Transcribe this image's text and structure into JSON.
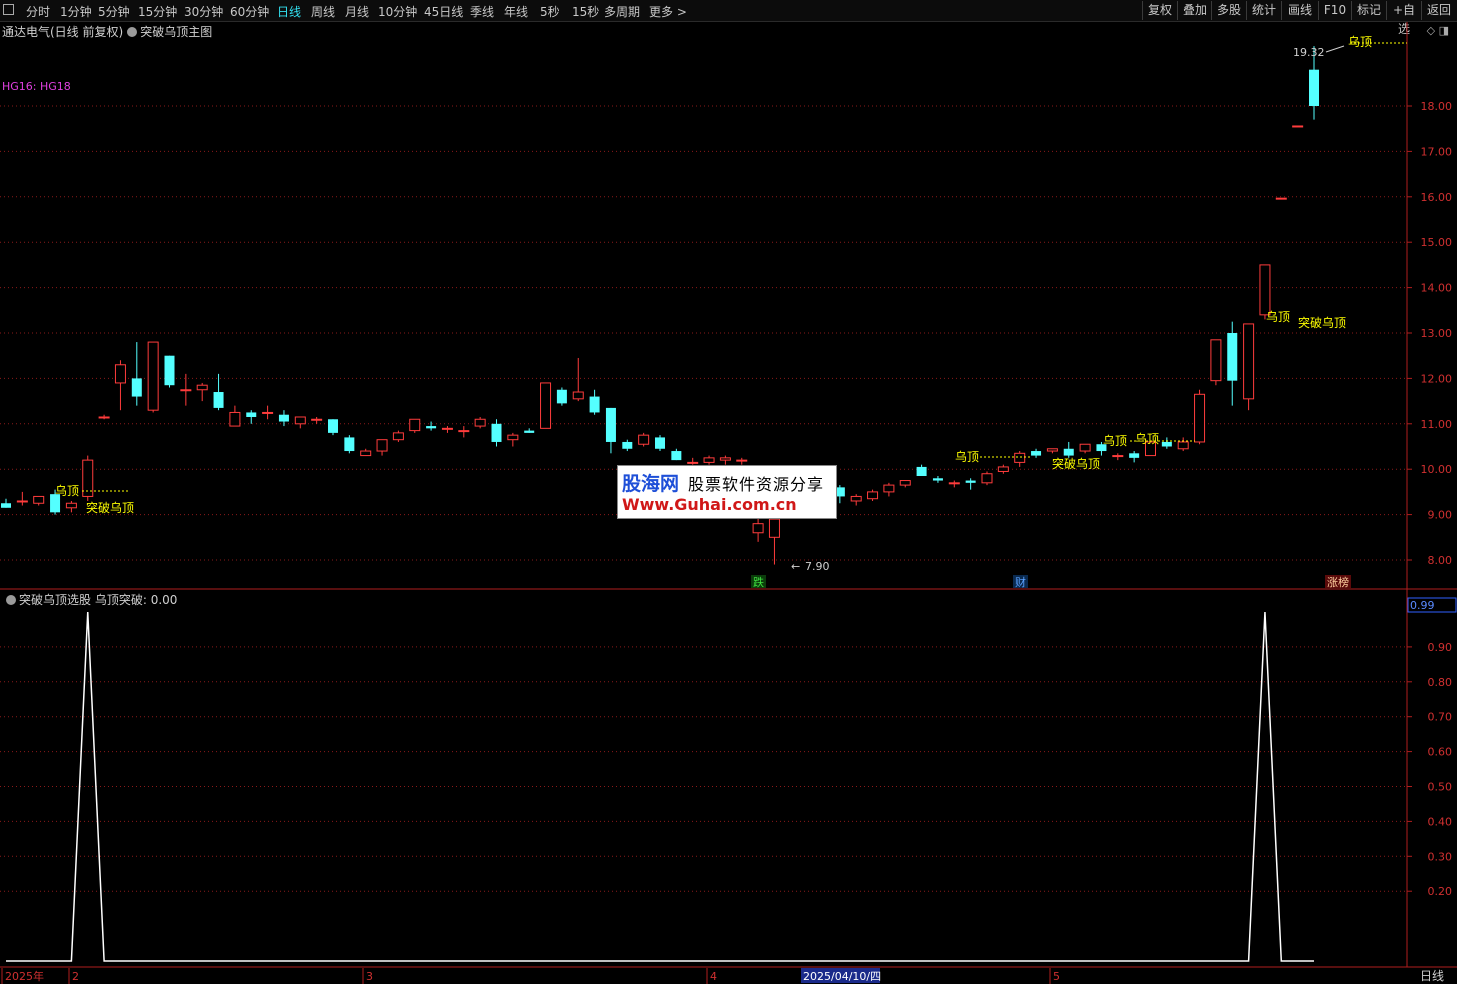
{
  "toolbar": {
    "periods": [
      "分时",
      "1分钟",
      "5分钟",
      "15分钟",
      "30分钟",
      "60分钟",
      "日线",
      "周线",
      "月线",
      "10分钟",
      "45日线",
      "季线",
      "年线",
      "5秒",
      "15秒",
      "多周期",
      "更多 >"
    ],
    "active": "日线",
    "right_buttons": [
      "复权",
      "叠加",
      "多股",
      "统计",
      "画线",
      "F10",
      "标记",
      "+自选",
      "返回"
    ]
  },
  "main_panel": {
    "stock_info": "通达电气(日线 前复权)",
    "indicator_name": "突破乌顶主图",
    "hg_label": "HG16: HG18",
    "top_icons": "◇ ◨",
    "price_axis": [
      "18.00",
      "17.00",
      "16.00",
      "15.00",
      "14.00",
      "13.00",
      "12.00",
      "11.00",
      "10.00",
      "9.00",
      "8.00"
    ],
    "high_marker": "19.32",
    "low_marker": "7.90",
    "signal_labels": [
      "乌顶",
      "突破乌顶"
    ],
    "event_tags": [
      "跌",
      "财",
      "涨榜"
    ]
  },
  "sub_panel": {
    "indicator_name": "突破乌顶选股",
    "value_label": "乌顶突破: 0.00",
    "current_value": "0.99",
    "axis": [
      "0.90",
      "0.80",
      "0.70",
      "0.60",
      "0.50",
      "0.40",
      "0.30",
      "0.20"
    ]
  },
  "timeline": {
    "labels": [
      "2025年",
      "2",
      "3",
      "4",
      "2025/04/10/四",
      "5"
    ],
    "period_label": "日线"
  },
  "watermark": {
    "brand": "股海网",
    "slogan": "股票软件资源分享",
    "url": "Www.Guhai.com.cn"
  },
  "colors": {
    "up": "#ff3c3c",
    "down": "#54ffff",
    "signal": "#ffff00",
    "grid": "#8a1a1a",
    "hg": "#e040e0"
  },
  "chart_data": {
    "type": "candlestick",
    "ylabel": "",
    "ylim": [
      7.6,
      19.5
    ],
    "candles": [
      {
        "o": 9.25,
        "h": 9.35,
        "l": 9.15,
        "c": 9.15
      },
      {
        "o": 9.3,
        "h": 9.5,
        "l": 9.2,
        "c": 9.3
      },
      {
        "o": 9.25,
        "h": 9.4,
        "l": 9.2,
        "c": 9.4
      },
      {
        "o": 9.45,
        "h": 9.55,
        "l": 9.0,
        "c": 9.05
      },
      {
        "o": 9.15,
        "h": 9.3,
        "l": 9.05,
        "c": 9.25
      },
      {
        "o": 9.4,
        "h": 10.3,
        "l": 9.3,
        "c": 10.2
      },
      {
        "o": 11.15,
        "h": 11.2,
        "l": 11.1,
        "c": 11.15
      },
      {
        "o": 11.9,
        "h": 12.4,
        "l": 11.3,
        "c": 12.3
      },
      {
        "o": 12.0,
        "h": 12.8,
        "l": 11.4,
        "c": 11.6
      },
      {
        "o": 11.3,
        "h": 12.8,
        "l": 11.25,
        "c": 12.8
      },
      {
        "o": 12.5,
        "h": 12.5,
        "l": 11.8,
        "c": 11.85
      },
      {
        "o": 11.75,
        "h": 12.1,
        "l": 11.4,
        "c": 11.75
      },
      {
        "o": 11.75,
        "h": 11.9,
        "l": 11.5,
        "c": 11.85
      },
      {
        "o": 11.7,
        "h": 12.1,
        "l": 11.3,
        "c": 11.35
      },
      {
        "o": 10.95,
        "h": 11.4,
        "l": 10.95,
        "c": 11.25
      },
      {
        "o": 11.25,
        "h": 11.3,
        "l": 11.0,
        "c": 11.15
      },
      {
        "o": 11.25,
        "h": 11.4,
        "l": 11.1,
        "c": 11.25
      },
      {
        "o": 11.2,
        "h": 11.3,
        "l": 10.95,
        "c": 11.05
      },
      {
        "o": 11.0,
        "h": 11.15,
        "l": 10.9,
        "c": 11.15
      },
      {
        "o": 11.1,
        "h": 11.15,
        "l": 11.0,
        "c": 11.1
      },
      {
        "o": 11.1,
        "h": 11.1,
        "l": 10.75,
        "c": 10.8
      },
      {
        "o": 10.7,
        "h": 10.75,
        "l": 10.35,
        "c": 10.4
      },
      {
        "o": 10.3,
        "h": 10.45,
        "l": 10.3,
        "c": 10.4
      },
      {
        "o": 10.4,
        "h": 10.65,
        "l": 10.3,
        "c": 10.65
      },
      {
        "o": 10.65,
        "h": 10.85,
        "l": 10.6,
        "c": 10.8
      },
      {
        "o": 10.85,
        "h": 11.1,
        "l": 10.8,
        "c": 11.1
      },
      {
        "o": 10.95,
        "h": 11.05,
        "l": 10.85,
        "c": 10.9
      },
      {
        "o": 10.9,
        "h": 10.95,
        "l": 10.8,
        "c": 10.9
      },
      {
        "o": 10.85,
        "h": 10.95,
        "l": 10.7,
        "c": 10.85
      },
      {
        "o": 10.95,
        "h": 11.15,
        "l": 10.9,
        "c": 11.1
      },
      {
        "o": 11.0,
        "h": 11.1,
        "l": 10.5,
        "c": 10.6
      },
      {
        "o": 10.65,
        "h": 10.8,
        "l": 10.5,
        "c": 10.75
      },
      {
        "o": 10.85,
        "h": 10.9,
        "l": 10.8,
        "c": 10.8
      },
      {
        "o": 10.9,
        "h": 11.9,
        "l": 10.9,
        "c": 11.9
      },
      {
        "o": 11.75,
        "h": 11.8,
        "l": 11.4,
        "c": 11.45
      },
      {
        "o": 11.55,
        "h": 12.45,
        "l": 11.5,
        "c": 11.7
      },
      {
        "o": 11.6,
        "h": 11.75,
        "l": 11.2,
        "c": 11.25
      },
      {
        "o": 11.35,
        "h": 11.35,
        "l": 10.35,
        "c": 10.6
      },
      {
        "o": 10.6,
        "h": 10.65,
        "l": 10.4,
        "c": 10.45
      },
      {
        "o": 10.55,
        "h": 10.8,
        "l": 10.5,
        "c": 10.75
      },
      {
        "o": 10.7,
        "h": 10.75,
        "l": 10.4,
        "c": 10.45
      },
      {
        "o": 10.4,
        "h": 10.45,
        "l": 10.2,
        "c": 10.2
      },
      {
        "o": 10.15,
        "h": 10.25,
        "l": 10.1,
        "c": 10.15
      },
      {
        "o": 10.15,
        "h": 10.3,
        "l": 10.1,
        "c": 10.25
      },
      {
        "o": 10.2,
        "h": 10.3,
        "l": 10.1,
        "c": 10.25
      },
      {
        "o": 10.2,
        "h": 10.25,
        "l": 10.1,
        "c": 10.2
      },
      {
        "o": 8.6,
        "h": 8.95,
        "l": 8.4,
        "c": 8.8
      },
      {
        "o": 8.5,
        "h": 9.0,
        "l": 7.9,
        "c": 8.9
      },
      {
        "o": 9.4,
        "h": 9.5,
        "l": 9.3,
        "c": 9.35
      },
      {
        "o": 9.5,
        "h": 9.55,
        "l": 9.35,
        "c": 9.5
      },
      {
        "o": 9.6,
        "h": 9.6,
        "l": 9.5,
        "c": 9.55
      },
      {
        "o": 9.6,
        "h": 9.65,
        "l": 9.25,
        "c": 9.4
      },
      {
        "o": 9.3,
        "h": 9.45,
        "l": 9.2,
        "c": 9.4
      },
      {
        "o": 9.35,
        "h": 9.55,
        "l": 9.3,
        "c": 9.5
      },
      {
        "o": 9.5,
        "h": 9.7,
        "l": 9.4,
        "c": 9.65
      },
      {
        "o": 9.65,
        "h": 9.75,
        "l": 9.6,
        "c": 9.75
      },
      {
        "o": 10.05,
        "h": 10.1,
        "l": 9.85,
        "c": 9.85
      },
      {
        "o": 9.8,
        "h": 9.85,
        "l": 9.7,
        "c": 9.75
      },
      {
        "o": 9.7,
        "h": 9.75,
        "l": 9.6,
        "c": 9.7
      },
      {
        "o": 9.75,
        "h": 9.8,
        "l": 9.55,
        "c": 9.7
      },
      {
        "o": 9.7,
        "h": 9.95,
        "l": 9.65,
        "c": 9.9
      },
      {
        "o": 9.95,
        "h": 10.1,
        "l": 9.9,
        "c": 10.05
      },
      {
        "o": 10.15,
        "h": 10.4,
        "l": 10.05,
        "c": 10.35
      },
      {
        "o": 10.4,
        "h": 10.45,
        "l": 10.25,
        "c": 10.3
      },
      {
        "o": 10.4,
        "h": 10.45,
        "l": 10.35,
        "c": 10.45
      },
      {
        "o": 10.45,
        "h": 10.6,
        "l": 10.25,
        "c": 10.3
      },
      {
        "o": 10.4,
        "h": 10.55,
        "l": 10.35,
        "c": 10.55
      },
      {
        "o": 10.55,
        "h": 10.6,
        "l": 10.3,
        "c": 10.4
      },
      {
        "o": 10.3,
        "h": 10.35,
        "l": 10.2,
        "c": 10.3
      },
      {
        "o": 10.35,
        "h": 10.4,
        "l": 10.15,
        "c": 10.25
      },
      {
        "o": 10.3,
        "h": 10.6,
        "l": 10.3,
        "c": 10.6
      },
      {
        "o": 10.6,
        "h": 10.7,
        "l": 10.45,
        "c": 10.5
      },
      {
        "o": 10.45,
        "h": 10.7,
        "l": 10.4,
        "c": 10.6
      },
      {
        "o": 10.6,
        "h": 11.75,
        "l": 10.55,
        "c": 11.65
      },
      {
        "o": 11.95,
        "h": 12.85,
        "l": 11.85,
        "c": 12.85
      },
      {
        "o": 13.0,
        "h": 13.25,
        "l": 11.4,
        "c": 11.95
      },
      {
        "o": 11.55,
        "h": 13.2,
        "l": 11.3,
        "c": 13.2
      },
      {
        "o": 13.4,
        "h": 14.5,
        "l": 13.3,
        "c": 14.5
      },
      {
        "o": 15.97,
        "h": 15.97,
        "l": 15.97,
        "c": 15.97
      },
      {
        "o": 17.56,
        "h": 17.56,
        "l": 17.56,
        "c": 17.56
      },
      {
        "o": 18.8,
        "h": 19.32,
        "l": 17.7,
        "c": 18.0
      }
    ],
    "signal_series": {
      "name": "乌顶突破",
      "values": [
        0,
        0,
        0,
        0,
        0,
        1,
        0,
        0,
        0,
        0,
        0,
        0,
        0,
        0,
        0,
        0,
        0,
        0,
        0,
        0,
        0,
        0,
        0,
        0,
        0,
        0,
        0,
        0,
        0,
        0,
        0,
        0,
        0,
        0,
        0,
        0,
        0,
        0,
        0,
        0,
        0,
        0,
        0,
        0,
        0,
        0,
        0,
        0,
        0,
        0,
        0,
        0,
        0,
        0,
        0,
        0,
        0,
        0,
        0,
        0,
        0,
        0,
        0,
        0,
        0,
        0,
        0,
        0,
        0,
        0,
        0,
        0,
        0,
        0,
        0,
        0,
        0,
        1,
        0,
        0,
        0
      ],
      "ylim": [
        0,
        1
      ]
    }
  }
}
